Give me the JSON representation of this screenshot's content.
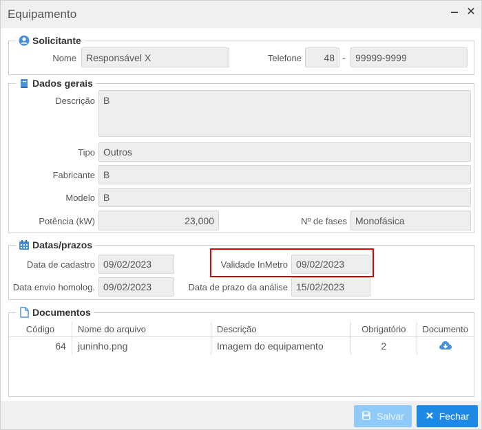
{
  "window": {
    "title": "Equipamento",
    "minimize_icon": "minimize-icon",
    "close_icon": "close-icon"
  },
  "solicitante": {
    "legend": "Solicitante",
    "nome_label": "Nome",
    "nome_value": "Responsável X",
    "telefone_label": "Telefone",
    "ddd_value": "48",
    "separator": "-",
    "numero_value": "99999-9999"
  },
  "dados_gerais": {
    "legend": "Dados gerais",
    "descricao_label": "Descrição",
    "descricao_value": "B",
    "tipo_label": "Tipo",
    "tipo_value": "Outros",
    "fabricante_label": "Fabricante",
    "fabricante_value": "B",
    "modelo_label": "Modelo",
    "modelo_value": "B",
    "potencia_label": "Potência (kW)",
    "potencia_value": "23,000",
    "fases_label": "Nº de fases",
    "fases_value": "Monofásica"
  },
  "datas": {
    "legend": "Datas/prazos",
    "cadastro_label": "Data de cadastro",
    "cadastro_value": "09/02/2023",
    "validade_label": "Validade InMetro",
    "validade_value": "09/02/2023",
    "homolog_label": "Data envio homolog.",
    "homolog_value": "09/02/2023",
    "prazo_label": "Data de prazo da análise",
    "prazo_value": "15/02/2023"
  },
  "documentos": {
    "legend": "Documentos",
    "columns": [
      "Código",
      "Nome do arquivo",
      "Descrição",
      "Obrigatório",
      "Documento"
    ],
    "rows": [
      {
        "codigo": "64",
        "nome": "juninho.png",
        "descricao": "Imagem do equipamento",
        "obrigatorio": "2",
        "documento_icon": "download-cloud-icon"
      }
    ]
  },
  "footer": {
    "salvar_label": "Salvar",
    "fechar_label": "Fechar"
  },
  "colors": {
    "primary": "#1e88e5",
    "disabled": "#90caf9",
    "icon_blue": "#4a8fd8",
    "highlight": "#e00000"
  }
}
